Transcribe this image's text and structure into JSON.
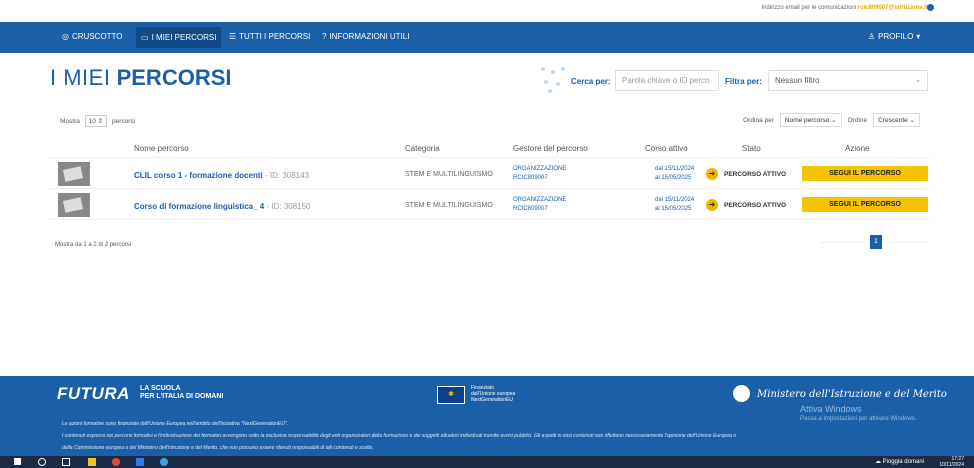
{
  "top_bar": {
    "email_label": "Indirizzo email per le comunicazioni",
    "email_value": "rcic809007@istruzione.it"
  },
  "nav": {
    "items": [
      {
        "label": "CRUSCOTTO",
        "icon": "dashboard-icon"
      },
      {
        "label": "I MIEI PERCORSI",
        "icon": "monitor-icon"
      },
      {
        "label": "TUTTI I PERCORSI",
        "icon": "list-icon"
      },
      {
        "label": "INFORMAZIONI UTILI",
        "icon": "help-icon"
      }
    ],
    "profile_label": "PROFILO"
  },
  "page": {
    "title_light": "I MIEI",
    "title_bold": "PERCORSI"
  },
  "search": {
    "cerca_label": "Cerca per:",
    "placeholder": "Parola chiave o ID perco",
    "filtra_label": "Filtra per:",
    "filter_value": "Nessun filtro"
  },
  "controls": {
    "mostra_label": "Mostra",
    "mostra_value": "10",
    "percorsi_label": "percorsi",
    "ordina_label": "Ordina per",
    "ordina_value": "Nome percorso",
    "ordine_label": "Ordine",
    "ordine_value": "Crescente"
  },
  "table": {
    "headers": [
      "Nome percorso",
      "Categoria",
      "Gestore del percorso",
      "Corso attivo",
      "Stato",
      "Azione"
    ],
    "rows": [
      {
        "name": "CLIL corso 1 - formazione docenti",
        "id": " - ID: 308143",
        "category": "STEM E MULTILINGUISMO",
        "org_line1": "ORGANIZZAZIONE",
        "org_line2": "RCIC809007",
        "date_from": "dal 15/11/2024",
        "date_to": "al 15/05/2025",
        "status": "PERCORSO ATTIVO",
        "action": "SEGUI IL PERCORSO"
      },
      {
        "name": "Corso di formazione linguistica_ 4",
        "id": " - ID: 308150",
        "category": "STEM E MULTILINGUISMO",
        "org_line1": "ORGANIZZAZIONE",
        "org_line2": "RCIC809007",
        "date_from": "dal 15/11/2024",
        "date_to": "al 15/05/2025",
        "status": "PERCORSO ATTIVO",
        "action": "SEGUI IL PERCORSO"
      }
    ],
    "info": "Mostra da 1 a 2 di 2 percorsi",
    "current_page": "1"
  },
  "footer": {
    "logo": "FUTURA",
    "logo_sub1": "LA SCUOLA",
    "logo_sub2": "PER L'ITALIA DI DOMANI",
    "eu_line1": "Finanziato",
    "eu_line2": "dall'Unione europea",
    "eu_line3": "NextGenerationEU",
    "ministero": "Ministero dell'Istruzione e del Merito",
    "disclaimer1": "Le azioni formative sono finanziate dall'Unione Europea nell'ambito dell'iniziativa \"NextGenerationEU\".",
    "disclaimer2": "I contenuti espressi nei percorsi formativi e l'individuazione dei formatori avvengono sotto la esclusiva responsabilità degli enti organizzatori della formazione e dei soggetti attuatori individuati tramite avvisi pubblici. Gli aspetti in essi contenuti non riflettono necessariamente l'opinione dell'Unione Europea o",
    "disclaimer3": "della Commissione europea o del Ministero dell'Istruzione e del Merito, che non possono essere ritenuti responsabili di tali contenuti e scelte."
  },
  "watermark": {
    "line1": "Attiva Windows",
    "line2": "Passa a Impostazioni per attivare Windows."
  },
  "taskbar": {
    "weather": "Pioggia domani",
    "time": "17:27",
    "date": "10/11/2024"
  },
  "colors": {
    "primary": "#1a5fa8",
    "accent": "#f5c400"
  }
}
